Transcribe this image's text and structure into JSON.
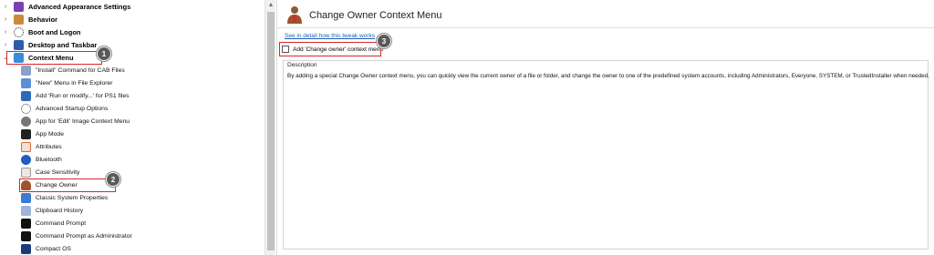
{
  "tree": {
    "top_items": [
      {
        "label": "Advanced Appearance Settings",
        "icon": "appearance-icon",
        "color": "#7a3fb0"
      },
      {
        "label": "Behavior",
        "icon": "behavior-icon",
        "color": "#c78a3a"
      },
      {
        "label": "Boot and Logon",
        "icon": "boot-icon",
        "color": "#333333"
      },
      {
        "label": "Desktop and Taskbar",
        "icon": "desktop-icon",
        "color": "#2b5ea8"
      },
      {
        "label": "Context Menu",
        "icon": "context-menu-icon",
        "color": "#3b8bd9"
      }
    ],
    "children": [
      {
        "label": "\"Install\" Command for CAB Files",
        "icon": "cab-icon",
        "color": "#8aa2c8"
      },
      {
        "label": "\"New\" Menu in File Explorer",
        "icon": "new-menu-icon",
        "color": "#5b8fd6"
      },
      {
        "label": "Add 'Run or modify...' for PS1 files",
        "icon": "powershell-icon",
        "color": "#2d6bb8"
      },
      {
        "label": "Advanced Startup Options",
        "icon": "startup-icon",
        "color": "#444444"
      },
      {
        "label": "App for 'Edit' Image Context Menu",
        "icon": "gear-icon",
        "color": "#777777"
      },
      {
        "label": "App Mode",
        "icon": "app-mode-icon",
        "color": "#222222"
      },
      {
        "label": "Attributes",
        "icon": "attributes-icon",
        "color": "#d96a2e"
      },
      {
        "label": "Bluetooth",
        "icon": "bluetooth-icon",
        "color": "#1f5fbf"
      },
      {
        "label": "Case Sensitivity",
        "icon": "case-icon",
        "color": "#9a9a9a"
      },
      {
        "label": "Change Owner",
        "icon": "user-icon",
        "color": "#a0522d"
      },
      {
        "label": "Classic System Properties",
        "icon": "system-icon",
        "color": "#3a7bd5"
      },
      {
        "label": "Clipboard History",
        "icon": "clipboard-icon",
        "color": "#9fb4d8"
      },
      {
        "label": "Command Prompt",
        "icon": "cmd-icon",
        "color": "#111111"
      },
      {
        "label": "Command Prompt as Administrator",
        "icon": "cmd-admin-icon",
        "color": "#111111"
      },
      {
        "label": "Compact OS",
        "icon": "compact-icon",
        "color": "#1a3d7a"
      }
    ]
  },
  "right": {
    "title": "Change Owner Context Menu",
    "link": "See in detail how this tweak works",
    "option_label": "Add 'Change owner' context menu",
    "option_checked": false,
    "description_title": "Description",
    "description": "By adding a special Change Owner context menu, you can quickly view the current owner of a file or folder, and change the owner to one of the predefined system accounts, including Administrators, Everyone, SYSTEM, or TrustedInstaller when needed."
  },
  "badges": [
    "1",
    "2",
    "3"
  ],
  "colors": {
    "highlight": "#d9262b",
    "link": "#1a5fb4",
    "badge": "#5a5a5a"
  }
}
